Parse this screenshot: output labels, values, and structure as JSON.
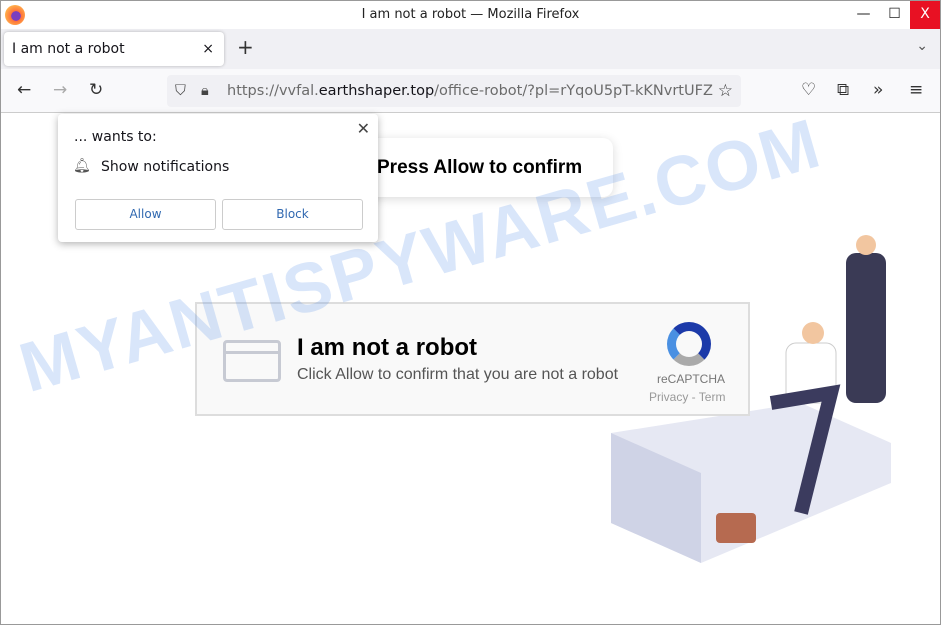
{
  "window": {
    "title": "I am not a robot — Mozilla Firefox",
    "minimize": "—",
    "maximize": "☐",
    "close": "X"
  },
  "tabs": [
    {
      "label": "I am not a robot",
      "close": "×"
    }
  ],
  "tabbar": {
    "new_tab": "+",
    "list_tabs": "⌄"
  },
  "nav": {
    "back": "←",
    "forward": "→",
    "reload": "↻",
    "url_prefix": "https://vvfal.",
    "url_domain": "earthshaper.top",
    "url_path": "/office-robot/?pl=rYqoU5pT-kKNvrtUFZ",
    "bookmark": "☆",
    "pocket": "♡",
    "extensions": "⧉",
    "more_tools": "»",
    "menu": "≡"
  },
  "popup": {
    "wants": "... wants to:",
    "permission": "Show notifications",
    "allow": "Allow",
    "block": "Block",
    "close": "✕"
  },
  "page": {
    "banner": "Press Allow to confirm",
    "captcha_title": "I am not a robot",
    "captcha_sub": "Click Allow to confirm that you are not a robot",
    "recaptcha": "reCAPTCHA",
    "privacy": "Privacy - Term"
  },
  "watermark": "MYANTISPYWARE.COM"
}
